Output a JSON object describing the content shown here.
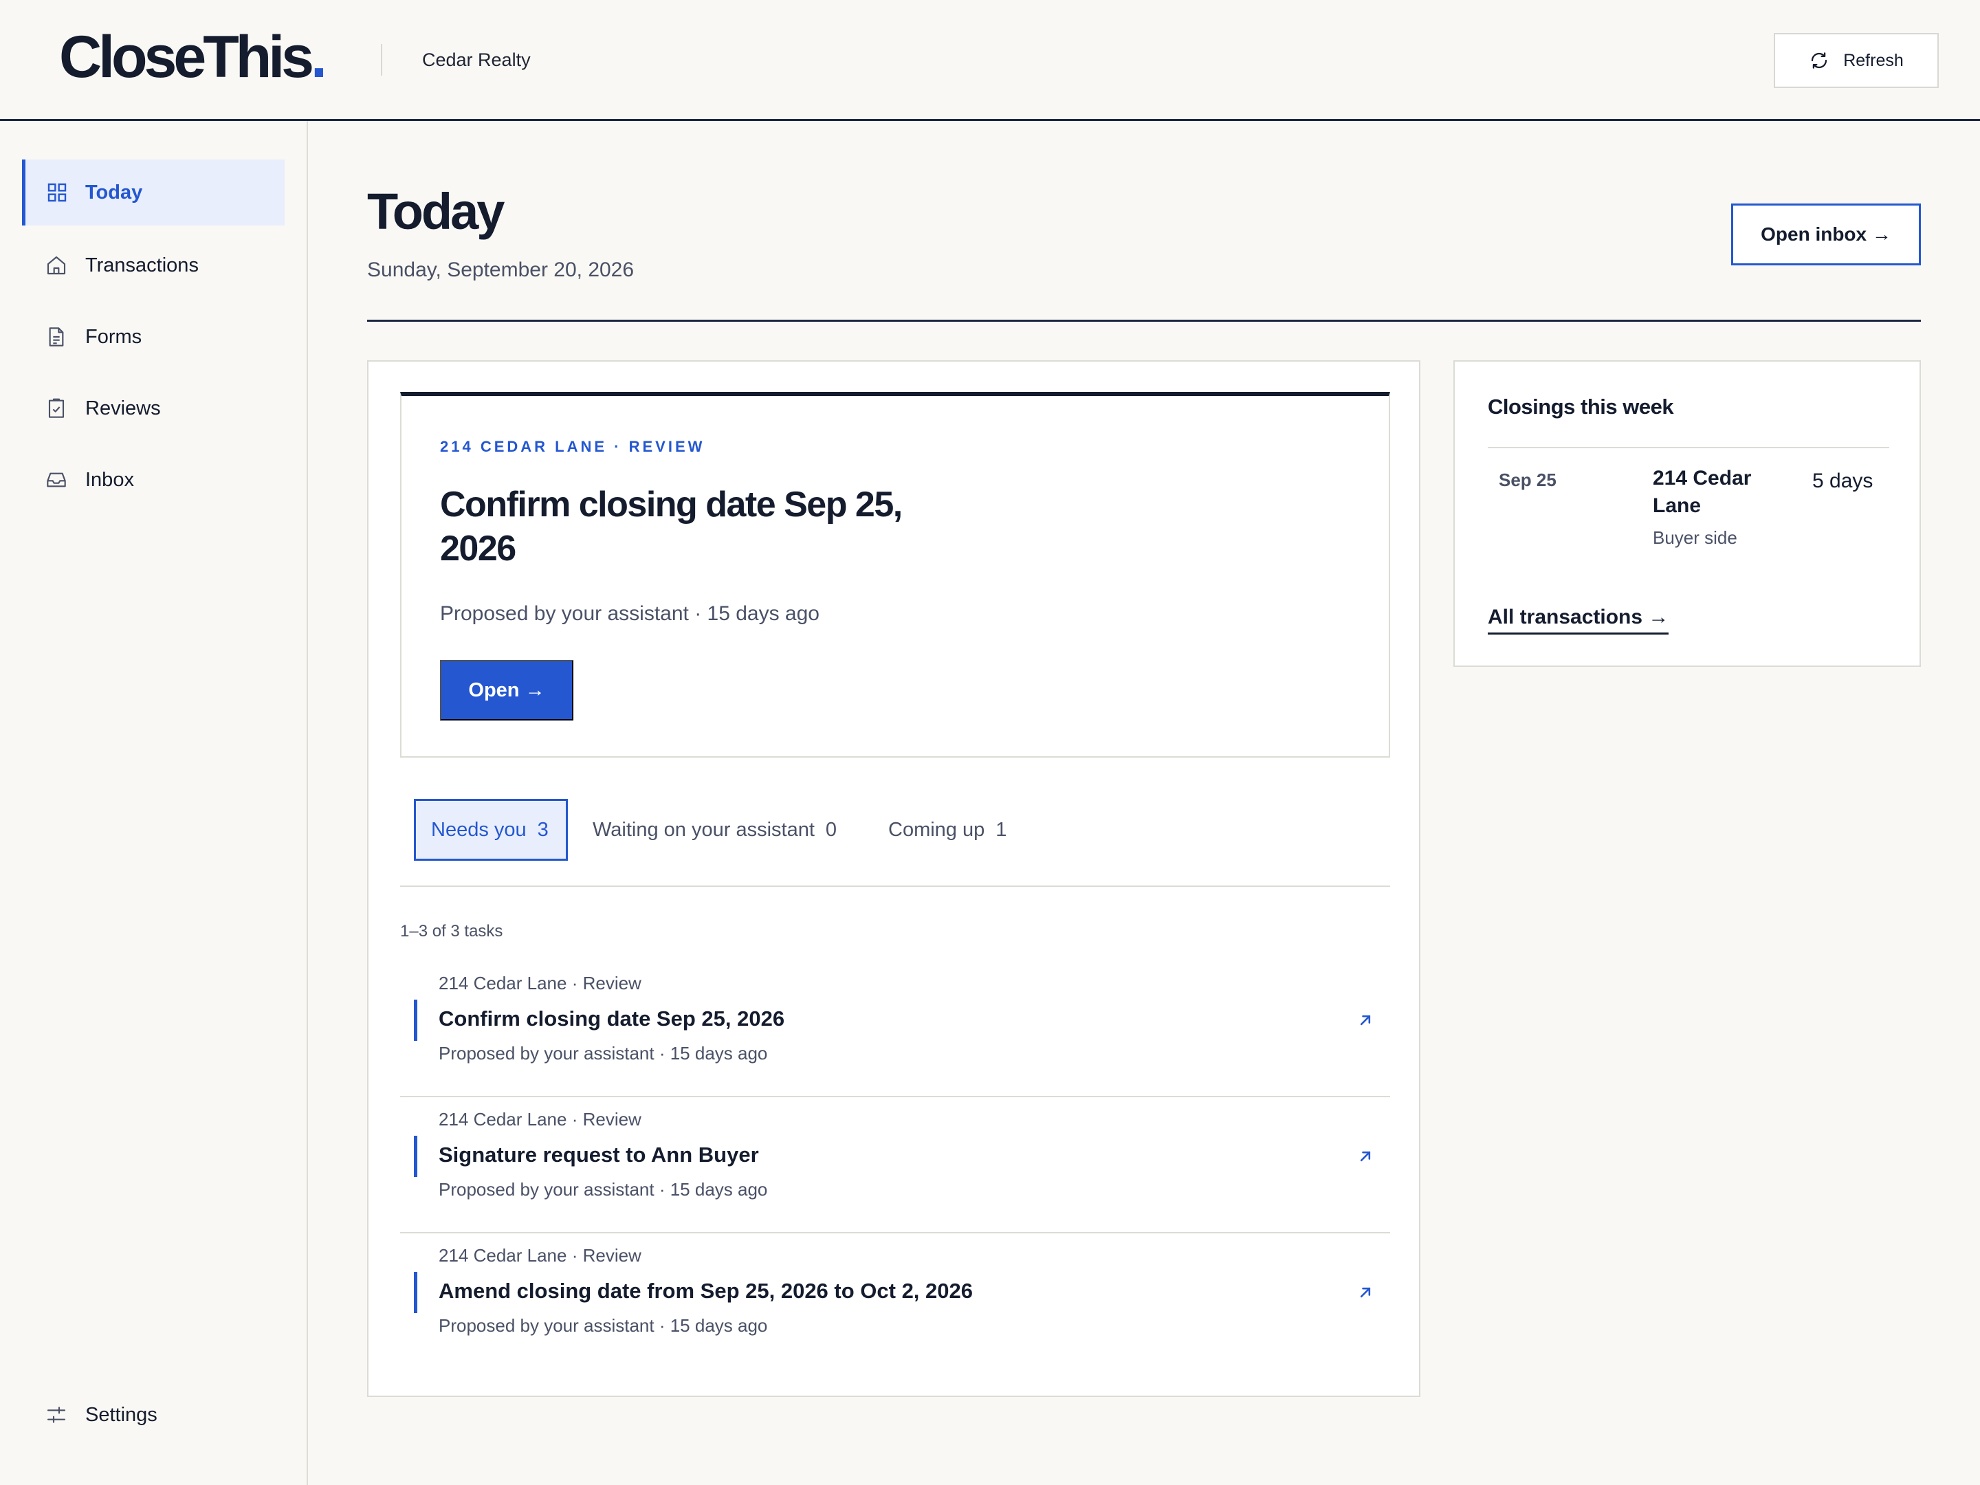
{
  "header": {
    "logo_text": "CloseThis",
    "logo_dot": ".",
    "org_name": "Cedar Realty",
    "refresh_label": "Refresh"
  },
  "sidebar": {
    "items": [
      {
        "label": "Today",
        "icon": "grid-icon",
        "active": true
      },
      {
        "label": "Transactions",
        "icon": "home-icon"
      },
      {
        "label": "Forms",
        "icon": "document-icon"
      },
      {
        "label": "Reviews",
        "icon": "clipboard-check-icon"
      },
      {
        "label": "Inbox",
        "icon": "inbox-icon"
      }
    ],
    "settings_label": "Settings"
  },
  "page": {
    "title": "Today",
    "date": "Sunday, September 20, 2026",
    "open_inbox_label": "Open inbox →"
  },
  "focus": {
    "kicker": "214 CEDAR LANE · REVIEW",
    "title": "Confirm closing date Sep 25, 2026",
    "meta": "Proposed by your assistant · 15 days ago",
    "open_label": "Open →"
  },
  "tabs": [
    {
      "label": "Needs you",
      "count": "3",
      "active": true
    },
    {
      "label": "Waiting on your assistant",
      "count": "0"
    },
    {
      "label": "Coming up",
      "count": "1"
    }
  ],
  "task_count": "1–3 of 3 tasks",
  "tasks": [
    {
      "context": "214 Cedar Lane · Review",
      "title": "Confirm closing date Sep 25, 2026",
      "meta": "Proposed by your assistant · 15 days ago"
    },
    {
      "context": "214 Cedar Lane · Review",
      "title": "Signature request to Ann Buyer",
      "meta": "Proposed by your assistant · 15 days ago"
    },
    {
      "context": "214 Cedar Lane · Review",
      "title": "Amend closing date from Sep 25, 2026 to Oct 2, 2026",
      "meta": "Proposed by your assistant · 15 days ago"
    }
  ],
  "closings": {
    "title": "Closings this week",
    "items": [
      {
        "date": "Sep 25",
        "address": "214 Cedar Lane",
        "side": "Buyer side",
        "days": "5 days"
      }
    ],
    "all_link": "All transactions →"
  },
  "colors": {
    "accent": "#2457d0",
    "ink": "#141c2e",
    "background": "#f9f8f4",
    "active_bg": "#e8eefb"
  }
}
